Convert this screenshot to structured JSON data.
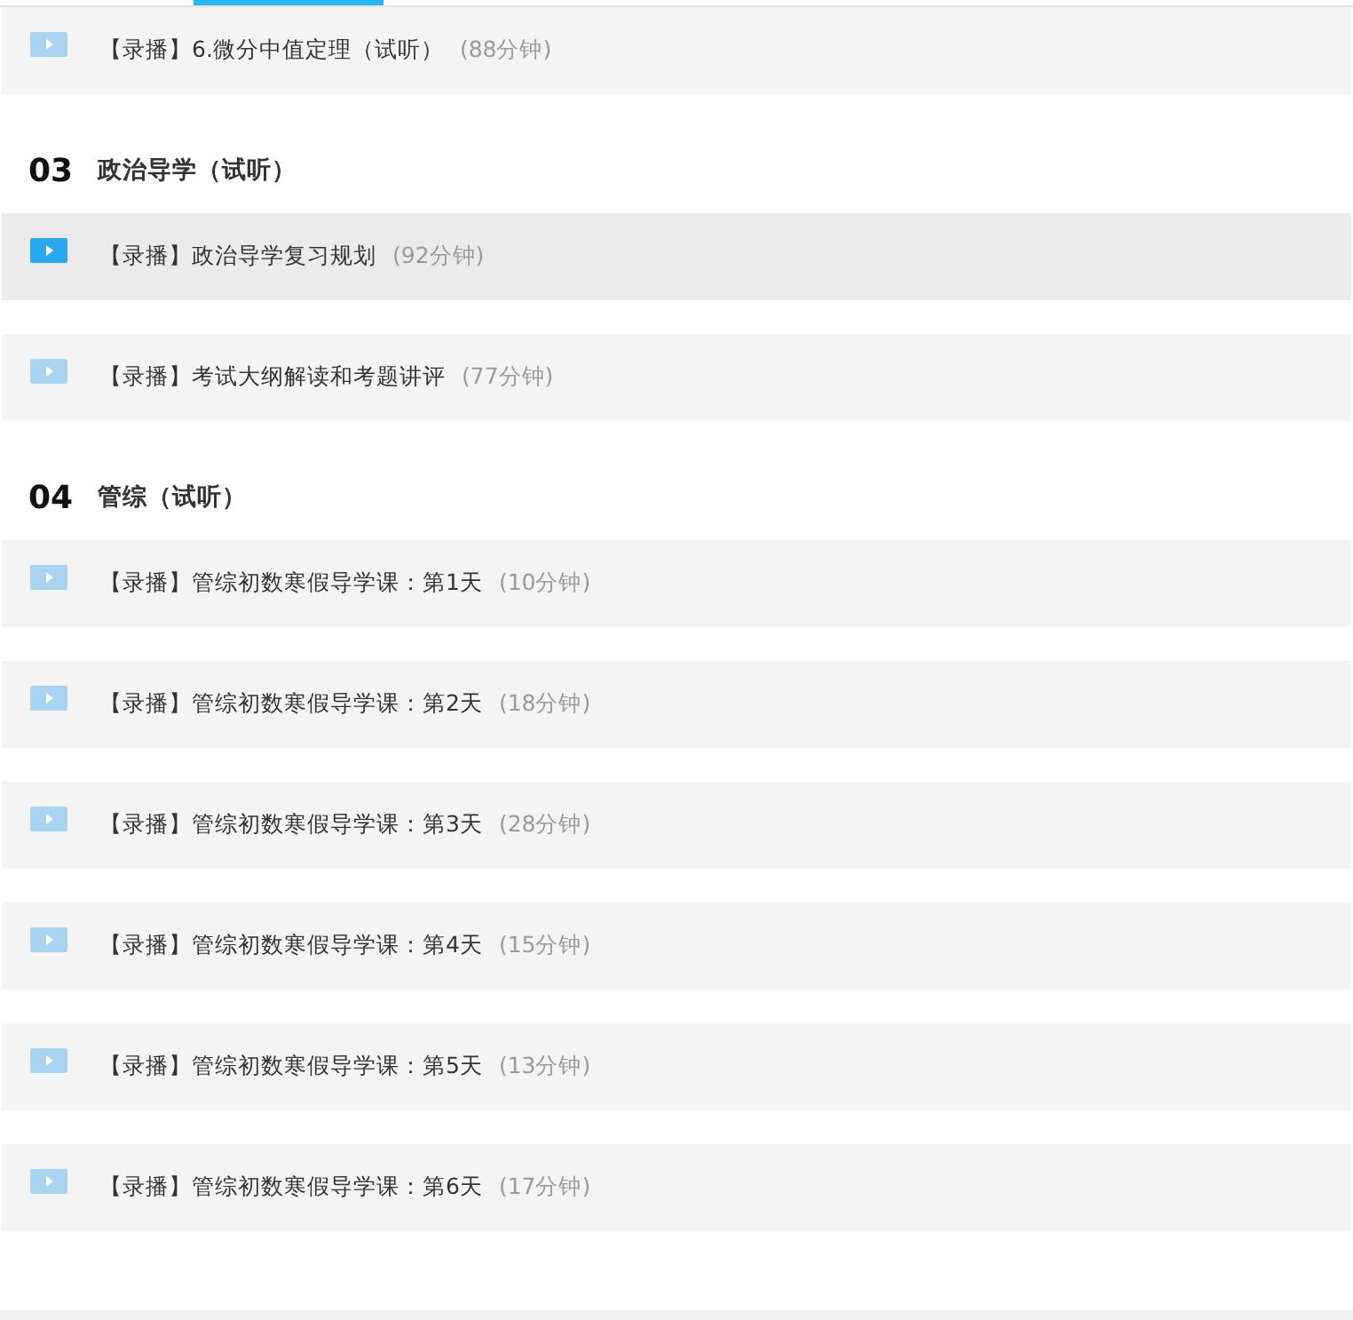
{
  "lessons": [
    {
      "tag": "【录播】",
      "title": "6.微分中值定理（试听）",
      "duration": "(88分钟)",
      "selected": false
    }
  ],
  "sections": [
    {
      "number": "03",
      "title": "政治导学（试听）",
      "lessons": [
        {
          "tag": "【录播】",
          "title": "政治导学复习规划",
          "duration": "(92分钟)",
          "selected": true
        },
        {
          "tag": "【录播】",
          "title": "考试大纲解读和考题讲评",
          "duration": "(77分钟)",
          "selected": false
        }
      ]
    },
    {
      "number": "04",
      "title": "管综（试听）",
      "lessons": [
        {
          "tag": "【录播】",
          "title": "管综初数寒假导学课：第1天",
          "duration": "(10分钟)",
          "selected": false
        },
        {
          "tag": "【录播】",
          "title": "管综初数寒假导学课：第2天",
          "duration": "(18分钟)",
          "selected": false
        },
        {
          "tag": "【录播】",
          "title": "管综初数寒假导学课：第3天",
          "duration": "(28分钟)",
          "selected": false
        },
        {
          "tag": "【录播】",
          "title": "管综初数寒假导学课：第4天",
          "duration": "(15分钟)",
          "selected": false
        },
        {
          "tag": "【录播】",
          "title": "管综初数寒假导学课：第5天",
          "duration": "(13分钟)",
          "selected": false
        },
        {
          "tag": "【录播】",
          "title": "管综初数寒假导学课：第6天",
          "duration": "(17分钟)",
          "selected": false
        }
      ]
    }
  ]
}
